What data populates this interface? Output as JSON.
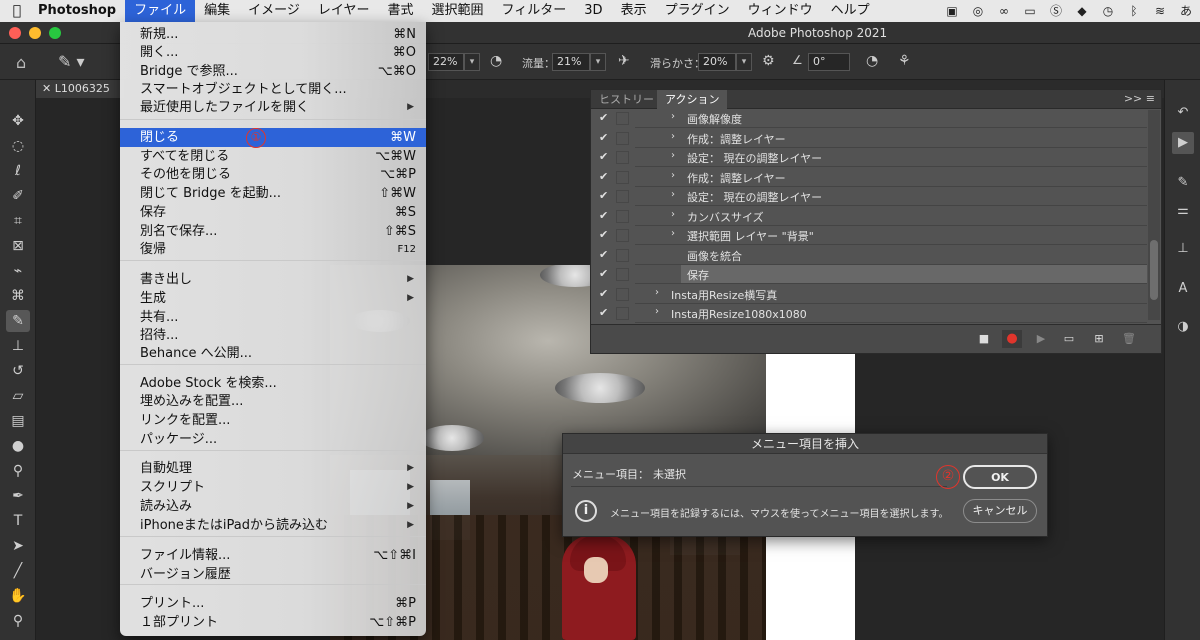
{
  "menubar": {
    "apple_icon": "apple-icon",
    "items": [
      "Photoshop",
      "ファイル",
      "編集",
      "イメージ",
      "レイヤー",
      "書式",
      "選択範囲",
      "フィルター",
      "3D",
      "表示",
      "プラグイン",
      "ウィンドウ",
      "ヘルプ"
    ],
    "right_icons": [
      "touch-bar-icon",
      "sync-icon",
      "creative-cloud-icon",
      "screen-icon",
      "s-icon",
      "bag-icon",
      "clock-icon",
      "bluetooth-icon",
      "wifi-icon"
    ],
    "input_method": "あ"
  },
  "window": {
    "title": "Adobe Photoshop 2021"
  },
  "options_bar": {
    "opacity_value": "22%",
    "flow_label": "流量：",
    "flow_value": "21%",
    "smoothing_label": "滑らかさ：",
    "smoothing_value": "20%",
    "angle_value": "0°"
  },
  "document": {
    "tab_label": "L1006325"
  },
  "file_menu": {
    "items": [
      {
        "label": "新規...",
        "shortcut": "⌘N"
      },
      {
        "label": "開く...",
        "shortcut": "⌘O"
      },
      {
        "label": "Bridge で参照...",
        "shortcut": "⌥⌘O"
      },
      {
        "label": "スマートオブジェクトとして開く...",
        "shortcut": ""
      },
      {
        "label": "最近使用したファイルを開く",
        "shortcut": ""
      },
      {
        "label": "閉じる",
        "shortcut": "⌘W"
      },
      {
        "label": "すべてを閉じる",
        "shortcut": "⌥⌘W"
      },
      {
        "label": "その他を閉じる",
        "shortcut": "⌥⌘P"
      },
      {
        "label": "閉じて Bridge を起動...",
        "shortcut": "⇧⌘W"
      },
      {
        "label": "保存",
        "shortcut": "⌘S"
      },
      {
        "label": "別名で保存...",
        "shortcut": "⇧⌘S"
      },
      {
        "label": "復帰",
        "shortcut": "F12"
      },
      {
        "label": "書き出し",
        "shortcut": ""
      },
      {
        "label": "生成",
        "shortcut": ""
      },
      {
        "label": "共有...",
        "shortcut": ""
      },
      {
        "label": "招待...",
        "shortcut": ""
      },
      {
        "label": "Behance へ公開...",
        "shortcut": ""
      },
      {
        "label": "Adobe Stock を検索...",
        "shortcut": ""
      },
      {
        "label": "埋め込みを配置...",
        "shortcut": ""
      },
      {
        "label": "リンクを配置...",
        "shortcut": ""
      },
      {
        "label": "パッケージ...",
        "shortcut": ""
      },
      {
        "label": "自動処理",
        "shortcut": ""
      },
      {
        "label": "スクリプト",
        "shortcut": ""
      },
      {
        "label": "読み込み",
        "shortcut": ""
      },
      {
        "label": "iPhoneまたはiPadから読み込む",
        "shortcut": ""
      },
      {
        "label": "ファイル情報...",
        "shortcut": "⌥⇧⌘I"
      },
      {
        "label": "バージョン履歴",
        "shortcut": ""
      },
      {
        "label": "プリント...",
        "shortcut": "⌘P"
      },
      {
        "label": "１部プリント",
        "shortcut": "⌥⇧⌘P"
      }
    ],
    "highlighted_item": "閉じる",
    "step_marker_1": "①"
  },
  "actions_panel": {
    "tabs": [
      "ヒストリー",
      "アクション"
    ],
    "collapse_icon": ">>",
    "menu_icon": "≡",
    "rows": [
      {
        "label": "画像解像度",
        "checked": true,
        "expandable": true
      },
      {
        "label": "作成：調整レイヤー",
        "checked": true,
        "expandable": true
      },
      {
        "label": "設定： 現在の調整レイヤー",
        "checked": true,
        "expandable": true
      },
      {
        "label": "作成：調整レイヤー",
        "checked": true,
        "expandable": true
      },
      {
        "label": "設定： 現在の調整レイヤー",
        "checked": true,
        "expandable": true
      },
      {
        "label": "カンバスサイズ",
        "checked": true,
        "expandable": true
      },
      {
        "label": "選択範囲 レイヤー \"背景\"",
        "checked": true,
        "expandable": true
      },
      {
        "label": "画像を統合",
        "checked": true,
        "expandable": false
      },
      {
        "label": "保存",
        "checked": true,
        "expandable": false,
        "selected": true
      },
      {
        "label": "Insta用Resize横写真",
        "checked": true,
        "expandable": true
      },
      {
        "label": "Insta用Resize1080x1080",
        "checked": true,
        "expandable": true
      }
    ],
    "footer_icons": [
      "stop-icon",
      "record-icon",
      "play-icon",
      "new-set-icon",
      "new-action-icon",
      "delete-icon"
    ],
    "record_color": "#e0352c"
  },
  "insert_menu_dialog": {
    "title": "メニュー項目を挿入",
    "item_label": "メニュー項目：",
    "item_value": "未選択",
    "message": "メニュー項目を記録するには、マウスを使ってメニュー項目を選択します。",
    "ok_label": "OK",
    "cancel_label": "キャンセル",
    "step_marker_2": "②"
  },
  "colors": {
    "menu_highlight": "#2d63d8",
    "annotation_red": "#e0352c",
    "panel_bg": "#535353",
    "app_bg": "#262626"
  }
}
